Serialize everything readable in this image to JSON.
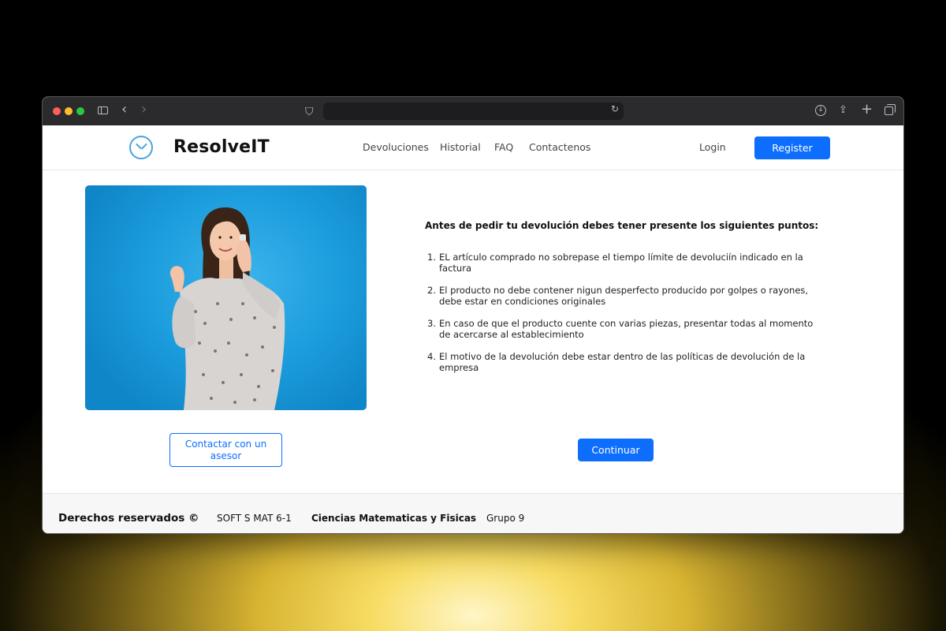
{
  "browser": {
    "url": ""
  },
  "navbar": {
    "brand": "ResolveIT",
    "links": [
      "Devoluciones",
      "Historial",
      "FAQ",
      "Contactenos"
    ],
    "login_label": "Login",
    "register_label": "Register"
  },
  "main": {
    "title": "Antes de pedir tu devolución debes tener presente los siguientes puntos:",
    "rules": [
      {
        "num": "1.",
        "text": "EL artículo comprado no sobrepase el tiempo límite de devoluciín indicado en la factura"
      },
      {
        "num": "2.",
        "text": "El producto no debe contener nigun desperfecto producido por golpes o rayones, debe estar en condiciones originales"
      },
      {
        "num": "3.",
        "text": "En caso de que el producto cuente con varias piezas, presentar todas al momento de acercarse al establecimiento"
      },
      {
        "num": "4.",
        "text": "El motivo de la devolución debe estar dentro de las políticas de devolución de la empresa"
      }
    ],
    "contact_label": "Contactar con un asesor",
    "continue_label": "Continuar"
  },
  "footer": {
    "rights": "Derechos reservados ©",
    "course": "SOFT S MAT 6-1",
    "faculty": "Ciencias Matematicas y Fisicas",
    "group": "Grupo 9"
  },
  "colors": {
    "accent": "#0d6efd",
    "logo": "#4aa3df",
    "hero_bg": "#1c9ddd"
  }
}
